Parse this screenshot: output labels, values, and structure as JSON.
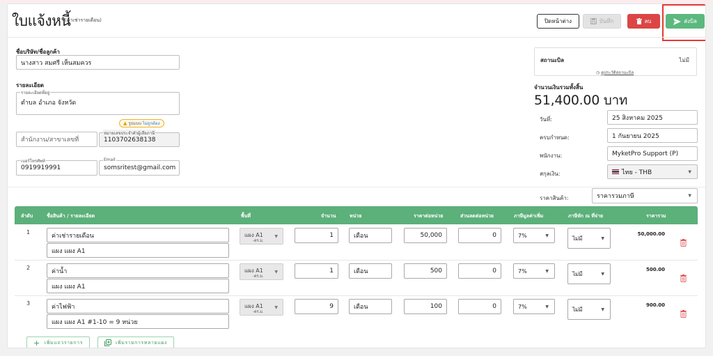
{
  "header": {
    "title": "ใบแจ้งหนี้",
    "subtitle": "(ค่าเช่ารายเดือน)",
    "buttons": {
      "close_window": "ปิดหน้าต่าง",
      "save": "บันทึก",
      "delete": "ลบ",
      "send_bill": "ส่งบิล"
    }
  },
  "customer": {
    "section_label": "ชื่อบริษัท/ชื่อลูกค้า",
    "name_value": "นางสาว สมศรี เห็นสมควร",
    "details_label": "รายละเอียด",
    "address_label": "รายละเอียดที่อยู่",
    "address_value": "ตำบล อำเภอ จังหวัด",
    "badge_text": "รูปแบบ",
    "badge_link": "ไม่ถูกต้อง",
    "branch_placeholder": "สำนักงาน/สาขาเลขที่",
    "tax_id_label": "หมายเลขประจำตัวผู้เสียภาษี",
    "tax_id_value": "1103702638138",
    "phone_label": "เบอร์โทรศัพท์",
    "phone_value": "0919919991",
    "email_label": "Email",
    "email_value": "somsritest@gmail.com"
  },
  "status": {
    "label": "สถานะบิล",
    "value": "ไม่มี",
    "history_link": "ดูประวัติสถานะบิล"
  },
  "summary": {
    "total_label": "จำนวนเงินรวมทั้งสิ้น",
    "total_value": "51,400.00 บาท",
    "date_label": "วันที่:",
    "date_value": "25 สิงหาคม 2025",
    "due_label": "ครบกำหนด:",
    "due_value": "1 กันยายน 2025",
    "employee_label": "พนักงาน:",
    "employee_value": "MyketPro Support (P)",
    "currency_label": "สกุลเงิน:",
    "currency_value": "ไทย - THB",
    "price_type_label": "ราคาสินค้า:",
    "price_type_value": "ราคารวมภาษี"
  },
  "table": {
    "columns": [
      "ลำดับ",
      "ชื่อสินค้า / รายละเอียด",
      "พื้นที่",
      "จำนวน",
      "หน่วย",
      "ราคาต่อหน่วย",
      "ส่วนลดต่อหน่วย",
      "ภาษีมูลค่าเพิ่ม",
      "ภาษีหัก ณ ที่จ่าย",
      "ราคารวม"
    ],
    "rows": [
      {
        "no": "1",
        "name": "ค่าเช่ารายเดือน",
        "detail": "แผง แผง A1",
        "area": "แผง A1",
        "area_sub": "-ตร.ม.",
        "qty": "1",
        "unit": "เดือน",
        "price": "50,000",
        "discount": "0",
        "vat": "7%",
        "wht": "ไม่มี",
        "total": "50,000.00"
      },
      {
        "no": "2",
        "name": "ค่าน้ำ",
        "detail": "แผง แผง A1",
        "area": "แผง A1",
        "area_sub": "-ตร.ม.",
        "qty": "1",
        "unit": "เดือน",
        "price": "500",
        "discount": "0",
        "vat": "7%",
        "wht": "ไม่มี",
        "total": "500.00"
      },
      {
        "no": "3",
        "name": "ค่าไฟฟ้า",
        "detail": "แผง แผง A1 #1-10 = 9 หน่วย",
        "area": "แผง A1",
        "area_sub": "-ตร.ม.",
        "qty": "9",
        "unit": "เดือน",
        "price": "100",
        "discount": "0",
        "vat": "7%",
        "wht": "ไม่มี",
        "total": "900.00"
      }
    ],
    "add_row": "เพิ่มแถวรายการ",
    "add_many": "เพิ่มรายการหลายแผง"
  },
  "colors": {
    "green": "#5cb87e",
    "red": "#dc4545",
    "highlight": "#e53935"
  }
}
